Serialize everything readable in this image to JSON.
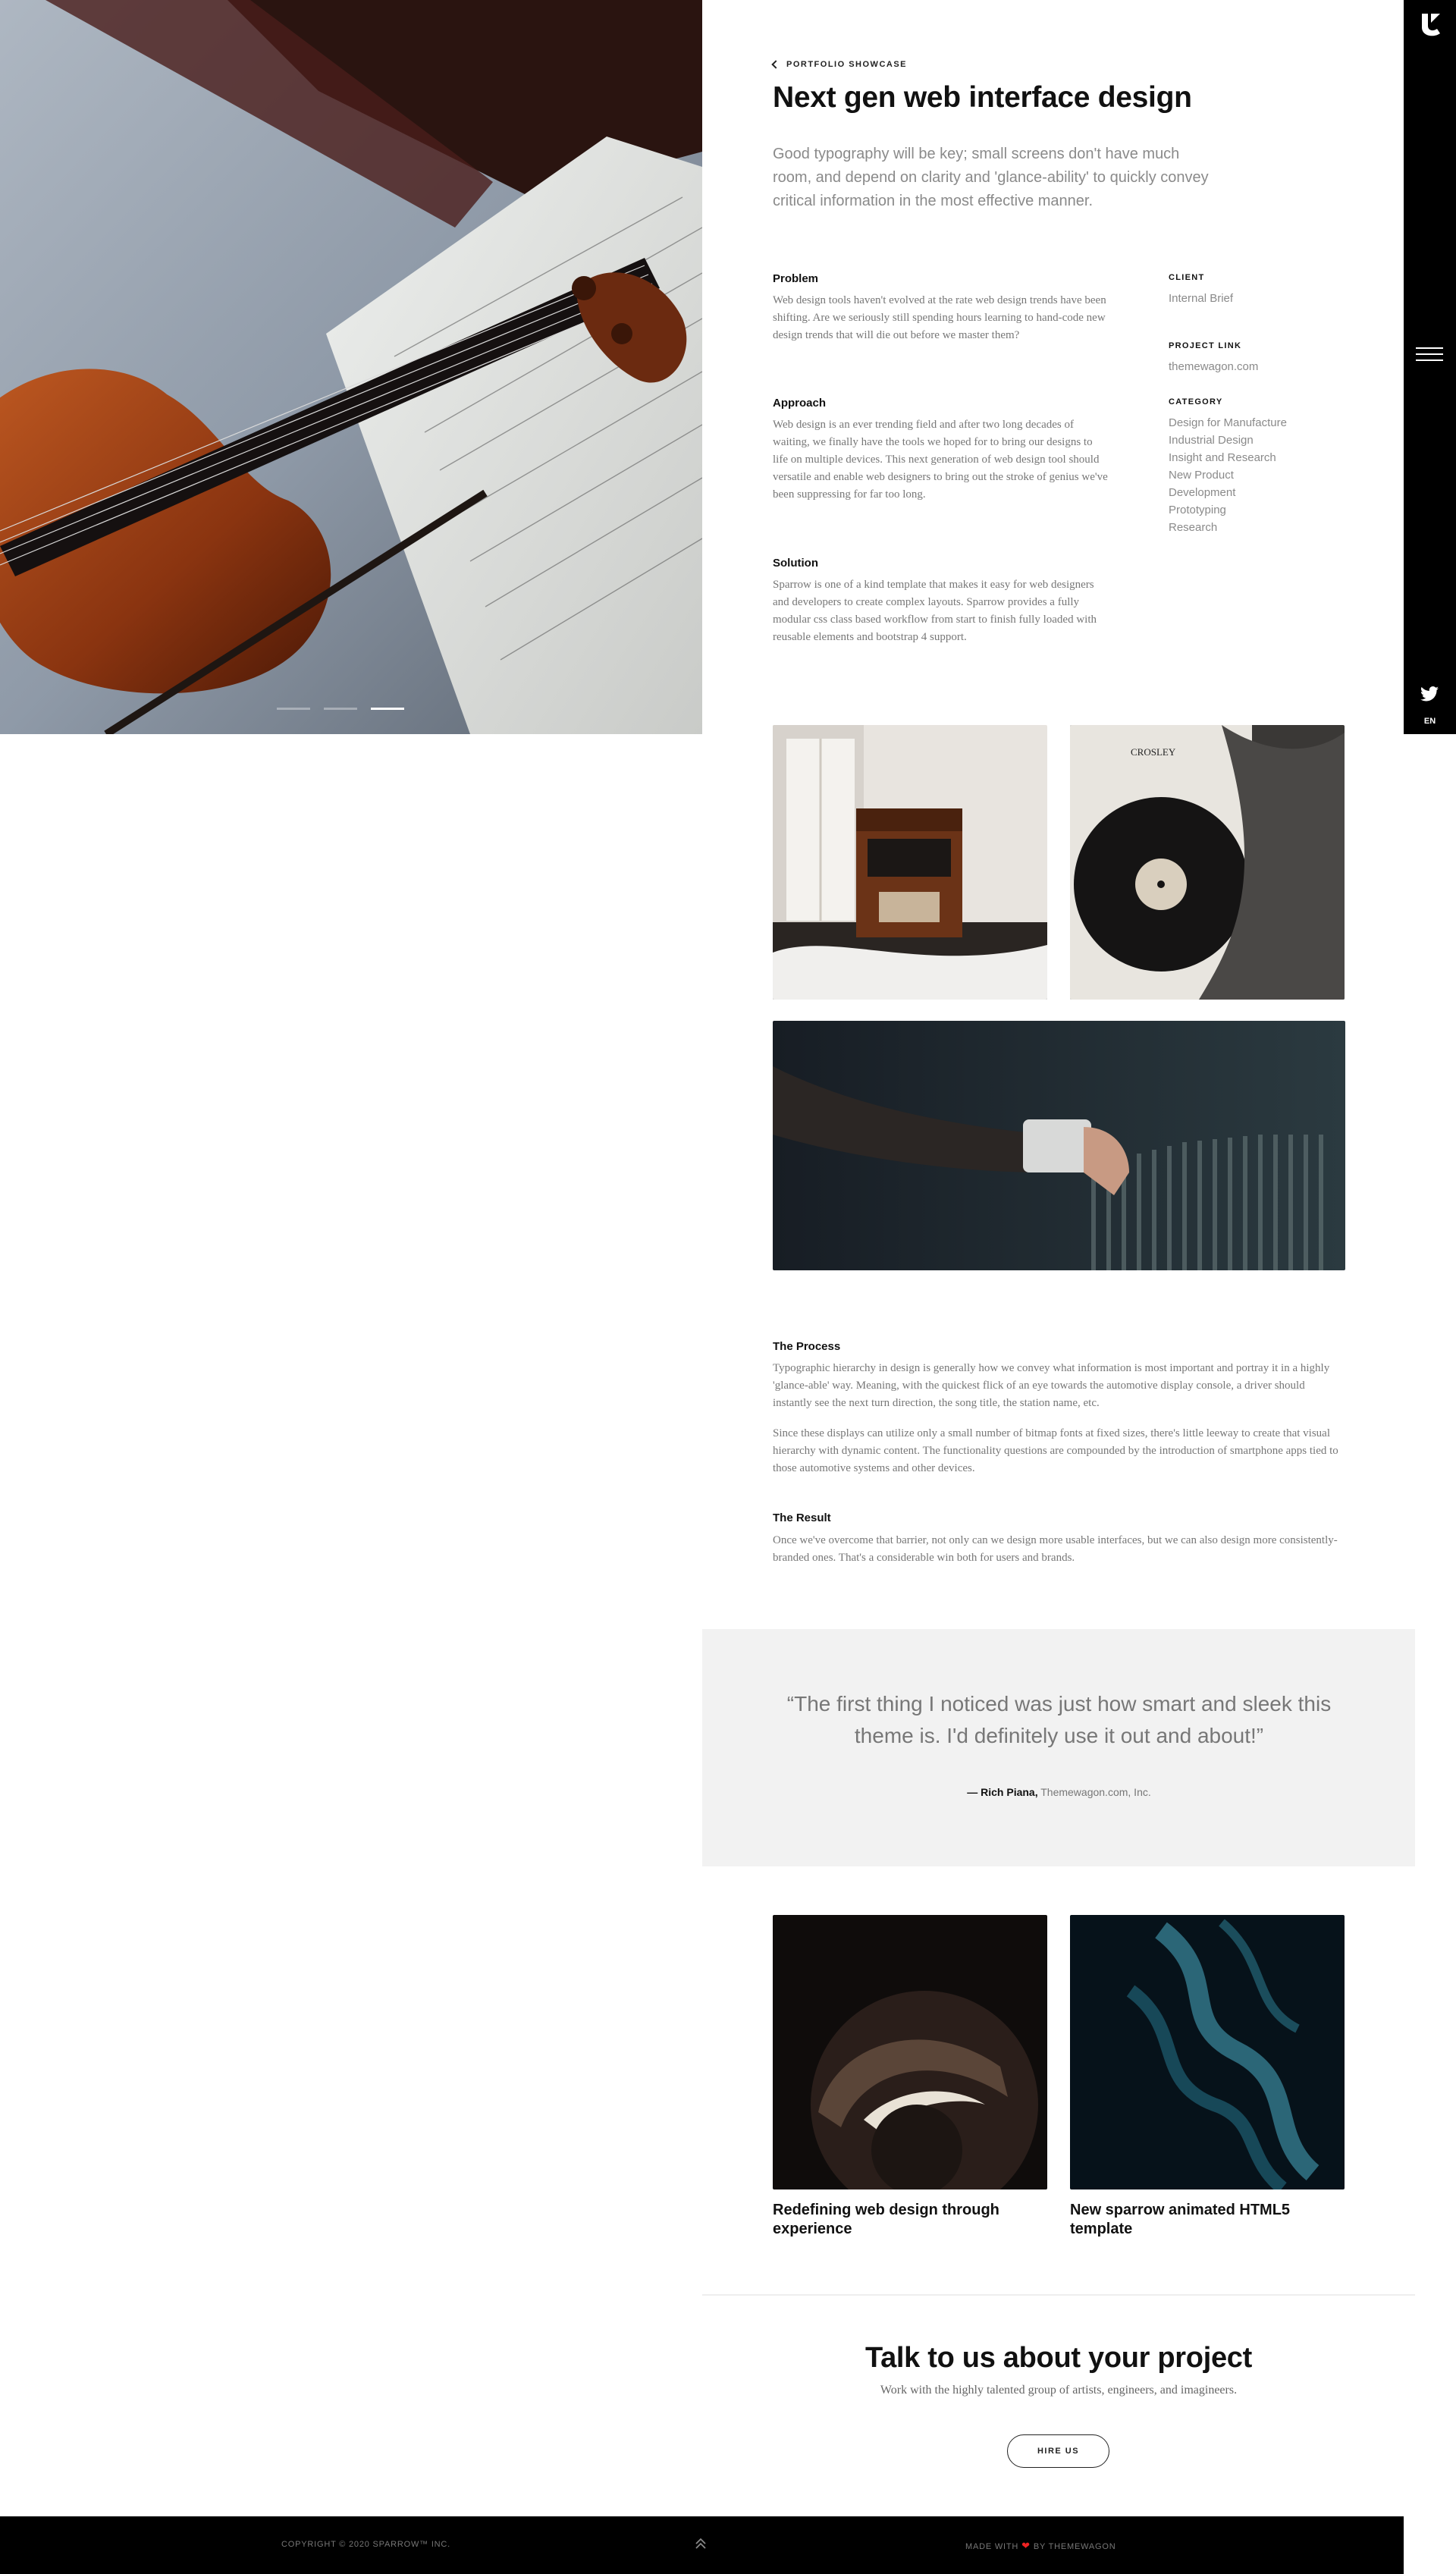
{
  "nav": {
    "back_label": "PORTFOLIO SHOWCASE",
    "language": "EN"
  },
  "project": {
    "title": "Next gen web interface design",
    "lede": "Good typography will be key; small screens don't have much room, and depend on clarity and 'glance-ability' to quickly convey critical information in the most effective manner."
  },
  "sections": [
    {
      "heading": "Problem",
      "body": "Web design tools haven't evolved at the rate web design trends have been shifting. Are we seriously still spending hours learning to hand-code new design trends that will die out before we master them?"
    },
    {
      "heading": "Approach",
      "body": "Web design is an ever trending field and after two long decades of waiting, we finally have the tools we hoped for to bring our designs to life on multiple devices. This next generation of web design tool should versatile and enable web designers to bring out the stroke of genius we've been suppressing for far too long."
    },
    {
      "heading": "Solution",
      "body": "Sparrow is one of a kind template that makes it easy for web designers and developers to create complex layouts. Sparrow provides a fully modular css class based workflow from start to finish fully loaded with reusable elements and bootstrap 4 support."
    }
  ],
  "meta": {
    "client_label": "CLIENT",
    "client_value": "Internal Brief",
    "link_label": "PROJECT LINK",
    "link_value": "themewagon.com",
    "category_label": "CATEGORY",
    "categories": [
      "Design for Manufacture",
      "Industrial Design",
      "Insight and Research",
      "New Product",
      "Development",
      "Prototyping",
      "Research"
    ]
  },
  "process": {
    "heading": "The Process",
    "paragraphs": [
      "Typographic hierarchy in design is generally how we convey what information is most important and portray it in a highly 'glance-able' way. Meaning, with the quickest flick of an eye towards the automotive display console, a driver should instantly see the next turn direction, the song title, the station name, etc.",
      "Since these displays can utilize only a small number of bitmap fonts at fixed sizes, there's little leeway to create that visual hierarchy with dynamic content. The functionality questions are compounded by the introduction of smartphone apps tied to those automotive systems and other devices."
    ]
  },
  "result": {
    "heading": "The Result",
    "body": "Once we've overcome that barrier, not only can we design more usable interfaces, but we can also design more consistently-branded ones. That's a considerable win both for users and brands."
  },
  "testimonial": {
    "quote": "“The first thing I noticed was just how smart and sleek this theme is. I'd definitely use it out and about!”",
    "author": "— Rich Piana,",
    "company": "Themewagon.com, Inc."
  },
  "related": [
    {
      "title": "Redefining web design through experience"
    },
    {
      "title": "New sparrow animated HTML5 template"
    }
  ],
  "cta": {
    "title": "Talk to us about your project",
    "subtitle": "Work with the highly talented group of artists, engineers, and imagineers.",
    "button": "HIRE US"
  },
  "footer": {
    "copyright": "COPYRIGHT © 2020 SPARROW™ INC.",
    "made_with": "MADE WITH",
    "made_by": "BY THEMEWAGON"
  },
  "hero": {
    "slide_count": 3,
    "active_slide": 3
  },
  "colors": {
    "sidebar": "#000000",
    "quote_bg": "#f2f2f2",
    "heart": "#e22222"
  }
}
